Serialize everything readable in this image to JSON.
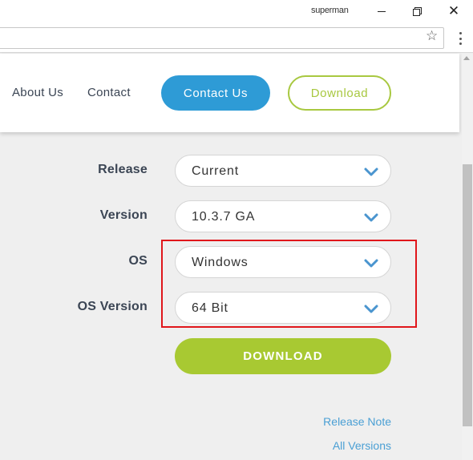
{
  "browser": {
    "profile_name": "superman",
    "bookmark_icon": "star-icon",
    "menu_icon": "more-vertical-icon"
  },
  "nav": {
    "about_label": "About Us",
    "contact_label": "Contact",
    "contact_us_label": "Contact Us",
    "download_label": "Download"
  },
  "form": {
    "release": {
      "label": "Release",
      "value": "Current"
    },
    "version": {
      "label": "Version",
      "value": "10.3.7 GA"
    },
    "os": {
      "label": "OS",
      "value": "Windows"
    },
    "os_version": {
      "label": "OS Version",
      "value": "64 Bit"
    },
    "submit_label": "DOWNLOAD"
  },
  "links": {
    "release_note": "Release Note",
    "all_versions": "All Versions"
  },
  "colors": {
    "primary_blue": "#2e9bd6",
    "accent_green": "#a8c932",
    "highlight_red": "#e0161b",
    "link_blue": "#4a9fd4",
    "chevron_blue": "#4a95cf"
  }
}
